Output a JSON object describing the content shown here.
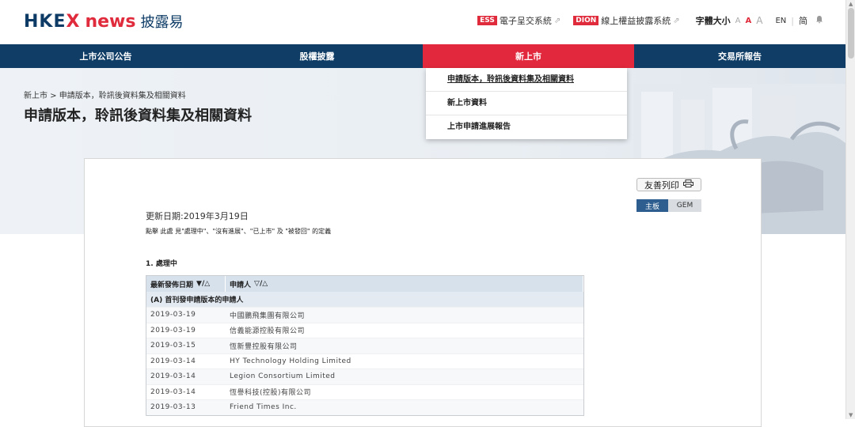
{
  "header": {
    "logo_main": "HKE",
    "logo_x": "X",
    "logo_news": "news",
    "logo_zh": "披露易",
    "links": [
      {
        "badge": "ESS",
        "label": "電子呈交系統"
      },
      {
        "badge": "DION",
        "label": "線上權益披露系統"
      }
    ],
    "font_size_label": "字體大小",
    "font_sizes": [
      "A",
      "A",
      "A"
    ],
    "lang_en": "EN",
    "lang_sep": "|",
    "lang_zh": "简"
  },
  "nav": {
    "items": [
      "上市公司公告",
      "股權披露",
      "新上市",
      "交易所報告"
    ],
    "active_index": 2
  },
  "dropdown": {
    "items": [
      "申請版本，聆訊後資料集及相關資料",
      "新上市資料",
      "上市申請進展報告"
    ]
  },
  "banner": {
    "breadcrumb": "新上市 > 申請版本，聆訊後資料集及相關資料",
    "title": "申請版本，聆訊後資料集及相關資料"
  },
  "content": {
    "print_label": "友善列印",
    "board_main": "主板",
    "board_gem": "GEM",
    "update_date": "更新日期:2019年3月19日",
    "note": "點擊 此處 見\"處理中\"、\"沒有進展\"、\"已上市\" 及 \"被發回\" 的定義",
    "section_title": "1. 處理中",
    "table": {
      "col_date": "最新發佈日期",
      "col_applicant": "申請人",
      "group": "(A) 首刊發申請版本的申請人",
      "rows": [
        {
          "date": "2019-03-19",
          "name": "中國鵬飛集團有限公司"
        },
        {
          "date": "2019-03-19",
          "name": "信義能源控股有限公司"
        },
        {
          "date": "2019-03-15",
          "name": "恆新豐控股有限公司"
        },
        {
          "date": "2019-03-14",
          "name": "HY Technology Holding Limited"
        },
        {
          "date": "2019-03-14",
          "name": "Legion Consortium Limited"
        },
        {
          "date": "2019-03-14",
          "name": "恆譽科技(控股)有限公司"
        },
        {
          "date": "2019-03-13",
          "name": "Friend Times Inc."
        }
      ]
    }
  },
  "colors": {
    "navy": "#0f3d66",
    "red": "#e2283c"
  }
}
